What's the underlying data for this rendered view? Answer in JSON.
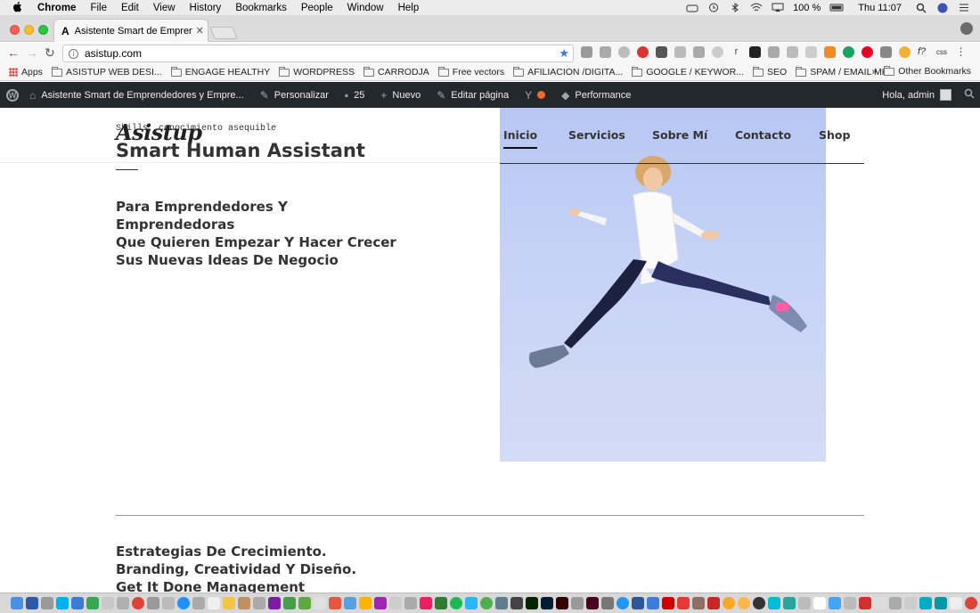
{
  "menubar": {
    "app": "Chrome",
    "items": [
      "File",
      "Edit",
      "View",
      "History",
      "Bookmarks",
      "People",
      "Window",
      "Help"
    ],
    "battery": "100 %",
    "clock": "Thu 11:07"
  },
  "browser": {
    "tab_title": "Asistente Smart de Emprendedores",
    "address": "asistup.com"
  },
  "bookmarks": {
    "apps": "Apps",
    "items": [
      "ASISTUP WEB DESI...",
      "ENGAGE HEALTHY",
      "WORDPRESS",
      "CARRODJA",
      "Free vectors",
      "AFILIACION /DIGITA...",
      "GOOGLE / KEYWOR...",
      "SEO",
      "SPAM / EMAIL MKT"
    ],
    "other": "Other Bookmarks",
    "chevron": "»"
  },
  "wpbar": {
    "site": "Asistente Smart de Emprendedores y Empre...",
    "customize": "Personalizar",
    "comments": "25",
    "new": "Nuevo",
    "edit": "Editar página",
    "performance": "Performance",
    "greeting": "Hola, admin"
  },
  "site": {
    "tagline": "Skills, conocimiento asequible",
    "logo": "Asistup",
    "title": "Smart Human Assistant",
    "nav": [
      "Inicio",
      "Servicios",
      "Sobre Mí",
      "Contacto",
      "Shop"
    ],
    "headline": [
      "Para Emprendedores Y Emprendedoras",
      "Que Quieren Empezar Y Hacer Crecer",
      "Sus Nuevas Ideas De Negocio"
    ],
    "services": [
      "Estrategias De Crecimiento.",
      "Branding, Creatividad Y Diseño.",
      "Get It Done Management"
    ]
  }
}
